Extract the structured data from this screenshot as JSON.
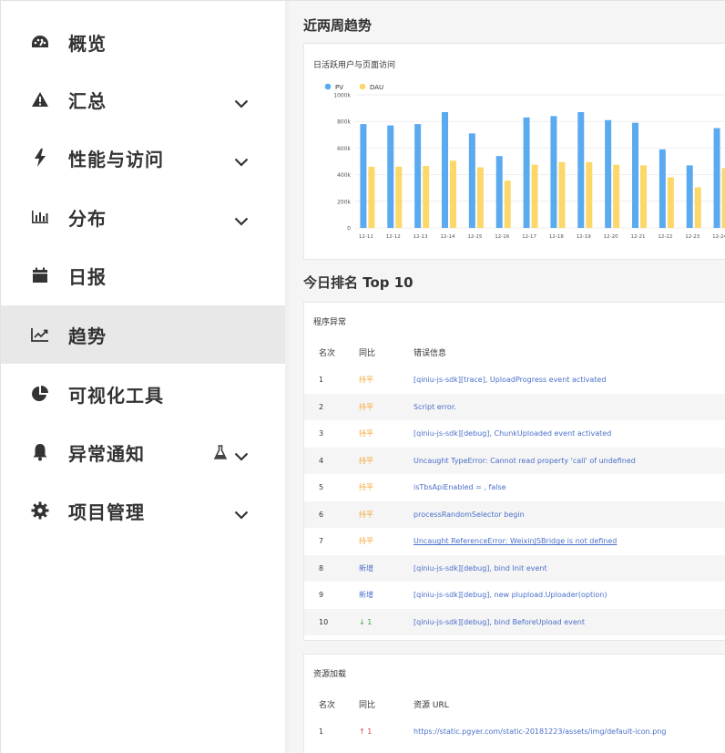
{
  "sidebar": {
    "items": [
      {
        "label": "概览",
        "icon": "dashboard-icon",
        "has_chevron": false
      },
      {
        "label": "汇总",
        "icon": "warning-icon",
        "has_chevron": true
      },
      {
        "label": "性能与访问",
        "icon": "lightning-icon",
        "has_chevron": true
      },
      {
        "label": "分布",
        "icon": "bar-chart-icon",
        "has_chevron": true
      },
      {
        "label": "日报",
        "icon": "calendar-icon",
        "has_chevron": false
      },
      {
        "label": "趋势",
        "icon": "trend-line-icon",
        "has_chevron": false,
        "active": true
      },
      {
        "label": "可视化工具",
        "icon": "pie-chart-icon",
        "has_chevron": false
      },
      {
        "label": "异常通知",
        "icon": "bell-icon",
        "has_chevron": true,
        "badge_icon": "flask-icon"
      },
      {
        "label": "项目管理",
        "icon": "gear-icon",
        "has_chevron": true
      }
    ],
    "active_color": "#e8e8e8"
  },
  "trend": {
    "section_title": "近两周趋势",
    "card_title": "日活跃用户与页面访问"
  },
  "chart_data": {
    "type": "bar",
    "title": "日活跃用户与页面访问",
    "categories": [
      "12-11",
      "12-12",
      "12-13",
      "12-14",
      "12-15",
      "12-16",
      "12-17",
      "12-18",
      "12-19",
      "12-20",
      "12-21",
      "12-22",
      "12-23",
      "12-24"
    ],
    "series": [
      {
        "name": "PV",
        "color": "#5aaaf0",
        "values": [
          780,
          770,
          780,
          870,
          710,
          540,
          830,
          840,
          870,
          810,
          790,
          590,
          470,
          750
        ]
      },
      {
        "name": "DAU",
        "color": "#fcd76a",
        "values": [
          460,
          460,
          465,
          505,
          455,
          355,
          475,
          495,
          495,
          475,
          470,
          380,
          305,
          450
        ]
      }
    ],
    "y_ticks": [
      "0",
      "200k",
      "400k",
      "600k",
      "800k",
      "1000k"
    ],
    "ylim": [
      0,
      1000
    ],
    "legend_position": "top-left",
    "grid": true
  },
  "ranking": {
    "section_title": "今日排名 Top 10",
    "errors": {
      "card_title": "程序异常",
      "headers": {
        "rank": "名次",
        "compare": "同比",
        "message": "错误信息"
      },
      "rows": [
        {
          "rank": "1",
          "compare": "持平",
          "compare_type": "flat",
          "message": "[qiniu-js-sdk][trace], UploadProgress event activated"
        },
        {
          "rank": "2",
          "compare": "持平",
          "compare_type": "flat",
          "message": "Script error."
        },
        {
          "rank": "3",
          "compare": "持平",
          "compare_type": "flat",
          "message": "[qiniu-js-sdk][debug], ChunkUploaded event activated"
        },
        {
          "rank": "4",
          "compare": "持平",
          "compare_type": "flat",
          "message": "Uncaught TypeError: Cannot read property 'call' of undefined"
        },
        {
          "rank": "5",
          "compare": "持平",
          "compare_type": "flat",
          "message": "isTbsApiEnabled = , false"
        },
        {
          "rank": "6",
          "compare": "持平",
          "compare_type": "flat",
          "message": "processRandomSelector begin"
        },
        {
          "rank": "7",
          "compare": "持平",
          "compare_type": "flat",
          "message": "Uncaught ReferenceError: WeixinJSBridge is not defined",
          "underline": true
        },
        {
          "rank": "8",
          "compare": "新增",
          "compare_type": "new",
          "message": "[qiniu-js-sdk][debug], bind Init event"
        },
        {
          "rank": "9",
          "compare": "新增",
          "compare_type": "new",
          "message": "[qiniu-js-sdk][debug], new plupload.Uploader(option)"
        },
        {
          "rank": "10",
          "compare": "↓ 1",
          "compare_type": "down",
          "message": "[qiniu-js-sdk][debug], bind BeforeUpload event"
        }
      ]
    },
    "resources": {
      "card_title": "资源加载",
      "headers": {
        "rank": "名次",
        "compare": "同比",
        "message": "资源 URL"
      },
      "rows": [
        {
          "rank": "1",
          "compare": "↑ 1",
          "compare_type": "up",
          "message": "https://static.pgyer.com/static-20181223/assets/img/default-icon.png"
        }
      ]
    }
  },
  "colors": {
    "link": "#4a6fc9",
    "flat": "#f2a93b",
    "down": "#3aa845",
    "up": "#e04040"
  }
}
